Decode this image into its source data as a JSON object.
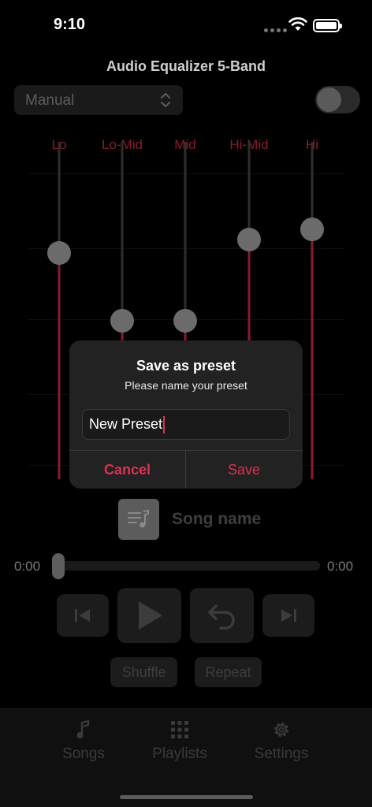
{
  "status_bar": {
    "time": "9:10"
  },
  "title": "Audio Equalizer 5-Band",
  "preset": {
    "value": "Manual"
  },
  "eq_enabled": false,
  "bands": [
    {
      "label": "Lo",
      "level": 0.67
    },
    {
      "label": "Lo-Mid",
      "level": 0.47
    },
    {
      "label": "Mid",
      "level": 0.47
    },
    {
      "label": "Hi-Mid",
      "level": 0.71
    },
    {
      "label": "Hi",
      "level": 0.74
    }
  ],
  "player": {
    "song_name": "Song name",
    "time_elapsed": "0:00",
    "time_total": "0:00",
    "progress": 0,
    "shuffle_label": "Shuffle",
    "repeat_label": "Repeat"
  },
  "tabs": [
    {
      "label": "Songs",
      "icon": "music-note-icon"
    },
    {
      "label": "Playlists",
      "icon": "grid-icon"
    },
    {
      "label": "Settings",
      "icon": "gear-icon"
    }
  ],
  "dialog": {
    "title": "Save as preset",
    "message": "Please name your preset",
    "input_value": "New Preset",
    "cancel_label": "Cancel",
    "save_label": "Save"
  },
  "colors": {
    "accent": "#e0304f",
    "eq_fill": "#8b1a2c"
  }
}
